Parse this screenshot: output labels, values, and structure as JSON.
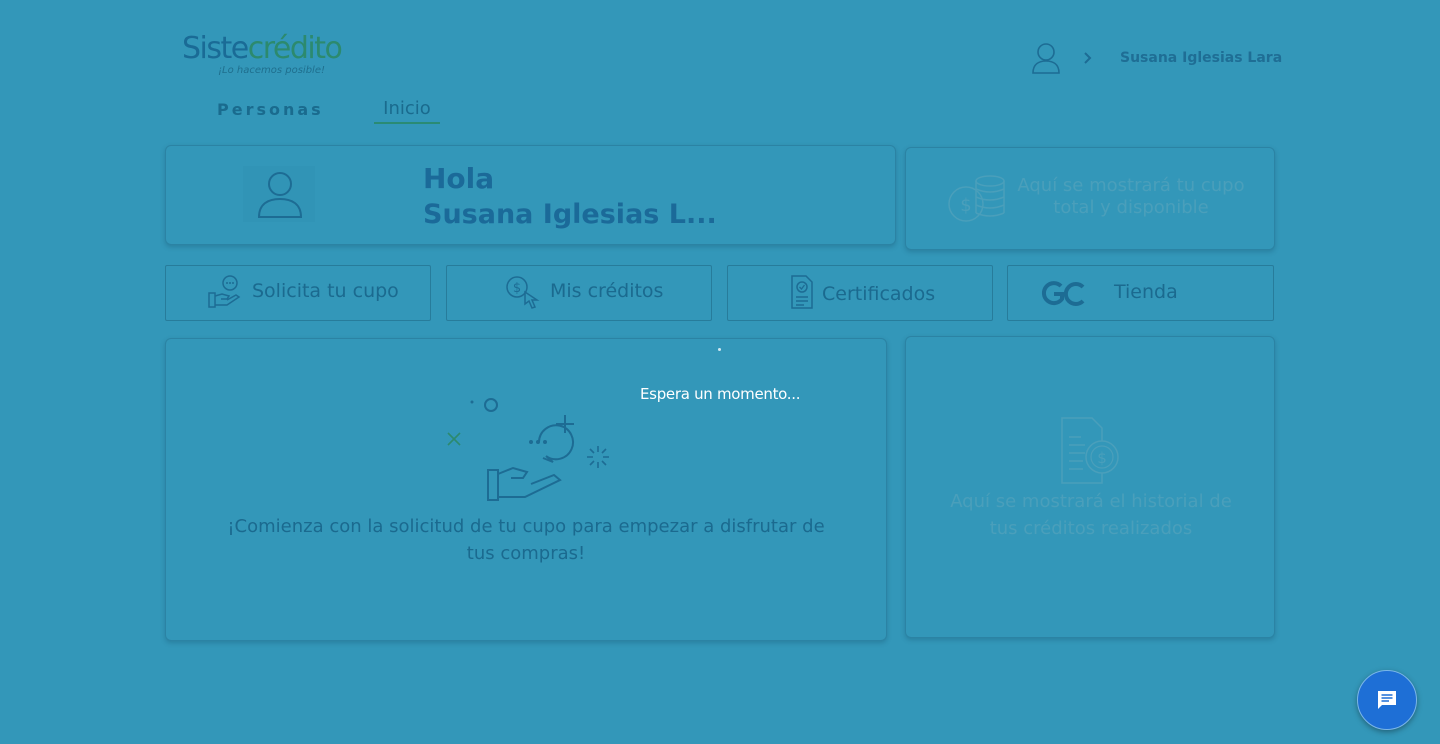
{
  "header": {
    "logo": {
      "name_part1": "Siste",
      "name_part2": "crédito",
      "tagline": "¡Lo hacemos posible!"
    },
    "user_name": "Susana Iglesias Lara",
    "icons": [
      "user-icon",
      "chevron-right-icon"
    ]
  },
  "tabs": [
    {
      "label": "Personas"
    },
    {
      "label": "Inicio",
      "active": true
    }
  ],
  "greeting": {
    "line1": "Hola",
    "line2": "Susana Iglesias L..."
  },
  "quota_card": {
    "text": "Aquí se mostrará tu cupo total y disponible",
    "icon": "coins-icon"
  },
  "nav_buttons": [
    {
      "label": "Solicita tu cupo",
      "icon": "hand-chat-icon"
    },
    {
      "label": "Mis créditos",
      "icon": "money-click-icon"
    },
    {
      "label": "Certificados",
      "icon": "certificate-icon"
    },
    {
      "label": "Tienda",
      "icon": "go-logo-icon"
    }
  ],
  "start_card": {
    "text": "¡Comienza con la solicitud de tu cupo para empezar a disfrutar de tus compras!",
    "icon": "hand-chat-illustration"
  },
  "history_card": {
    "text": "Aquí se mostrará el historial de tus créditos realizados",
    "icon": "document-money-icon"
  },
  "loading": {
    "text": "Espera un momento..."
  },
  "chat": {
    "icon": "chat-icon"
  },
  "colors": {
    "overlay_bg": "#3397b9",
    "brand_blue": "#1b6a99",
    "brand_green": "#2c8a6e",
    "chat_button": "#1e6fd6"
  }
}
